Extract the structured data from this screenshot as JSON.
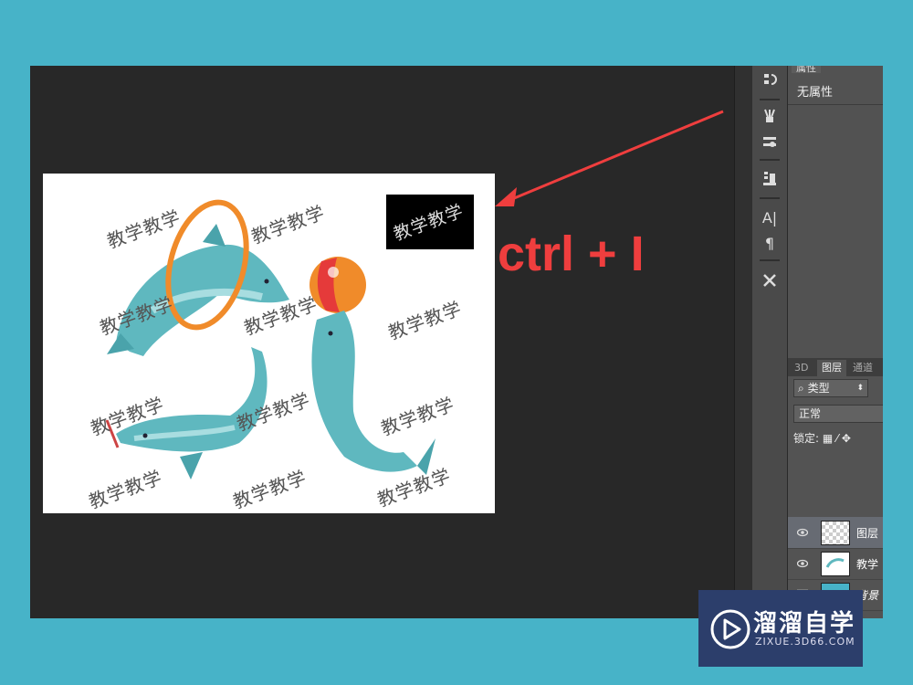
{
  "canvas": {
    "watermark_text": "教学教学",
    "selection_text": "教学教学"
  },
  "annotation": {
    "shortcut_text": "ctrl + I"
  },
  "properties_panel": {
    "tab_label": "属性",
    "no_properties": "无属性"
  },
  "layers_panel": {
    "tabs": [
      "3D",
      "图层",
      "通道"
    ],
    "filter_label": "类型",
    "blend_mode": "正常",
    "lock_label": "锁定:",
    "layers": [
      {
        "name": "图层",
        "visible": true,
        "selected": true
      },
      {
        "name": "教学",
        "visible": true,
        "selected": false
      },
      {
        "name": "背景",
        "visible": false,
        "selected": false
      }
    ]
  },
  "branding": {
    "name": "溜溜自学",
    "url": "ZIXUE.3D66.COM"
  },
  "icons": [
    "history-icon",
    "brush-presets-icon",
    "tool-presets-icon",
    "clone-source-icon",
    "character-icon",
    "paragraph-icon",
    "tools-icon",
    "search-icon",
    "eye-icon",
    "play-icon"
  ],
  "colors": {
    "annotation": "#ef3e3e",
    "badge": "#2c3e6b",
    "background": "#47b3c8"
  }
}
